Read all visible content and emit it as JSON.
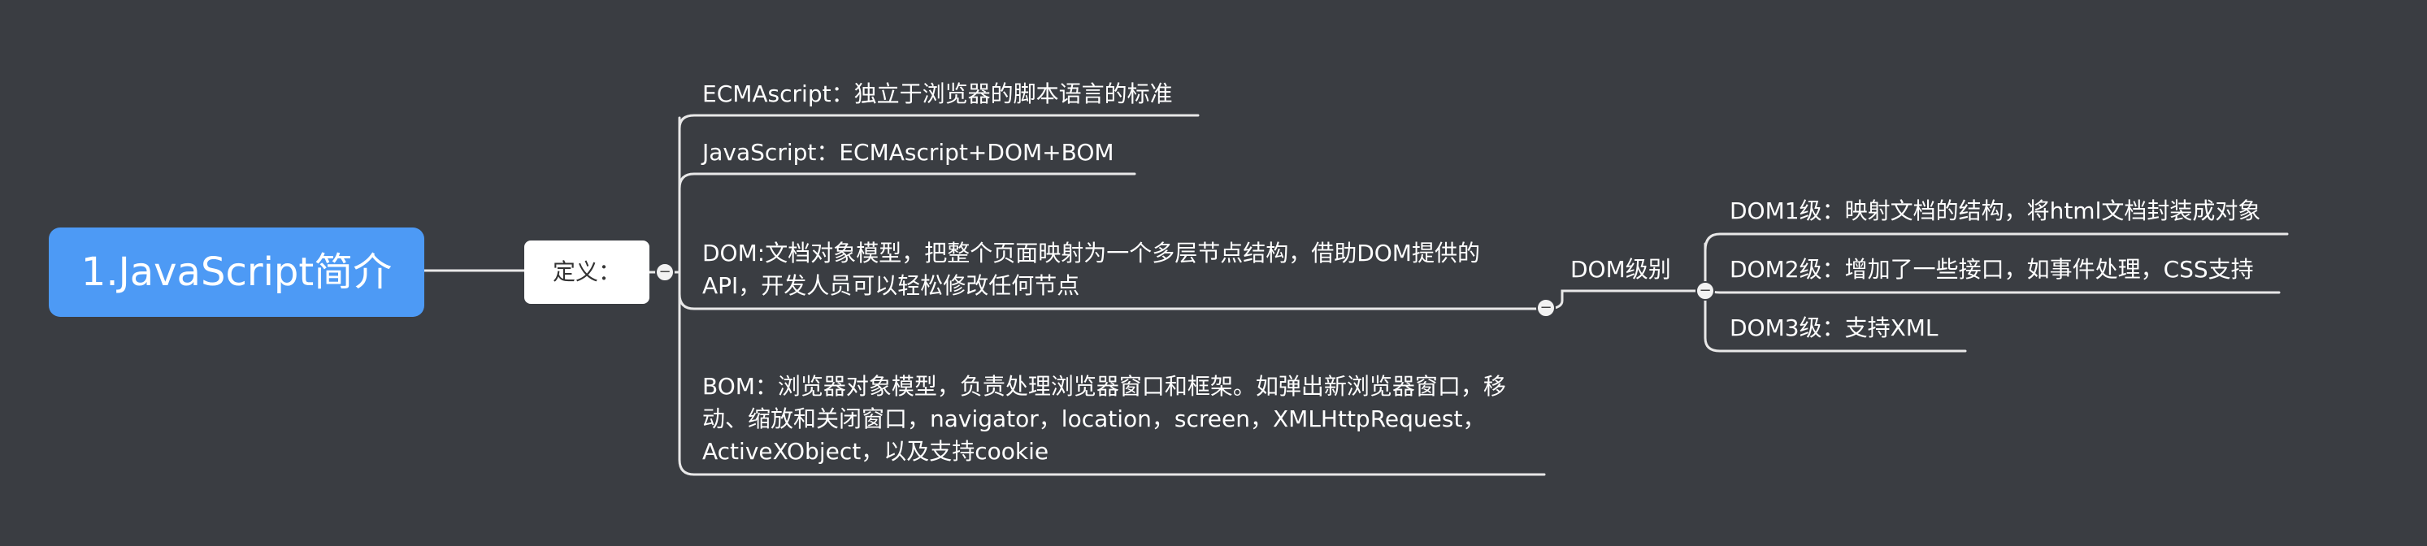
{
  "root": {
    "label": "1.JavaScript简介"
  },
  "definition": {
    "label": "定义：",
    "branches": [
      {
        "text": "ECMAscript：独立于浏览器的脚本语言的标准"
      },
      {
        "text": "JavaScript：ECMAscript+DOM+BOM"
      },
      {
        "text": "DOM:文档对象模型，把整个页面映射为一个多层节点结构，借助DOM提供的API，开发人员可以轻松修改任何节点"
      },
      {
        "text": "BOM：浏览器对象模型，负责处理浏览器窗口和框架。如弹出新浏览器窗口，移动、缩放和关闭窗口，navigator，location，screen，XMLHttpRequest，ActiveXObject，以及支持cookie"
      }
    ]
  },
  "dom_levels": {
    "label": "DOM级别",
    "items": [
      {
        "text": "DOM1级：映射文档的结构，将html文档封装成对象"
      },
      {
        "text": "DOM2级：增加了一些接口，如事件处理，CSS支持"
      },
      {
        "text": "DOM3级：支持XML"
      }
    ]
  },
  "colors": {
    "background": "#3a3d42",
    "root_fill": "#4d9af5",
    "line": "#e8e8e8",
    "text": "#ffffff"
  },
  "icons": {
    "collapse": "minus-circle-icon"
  }
}
